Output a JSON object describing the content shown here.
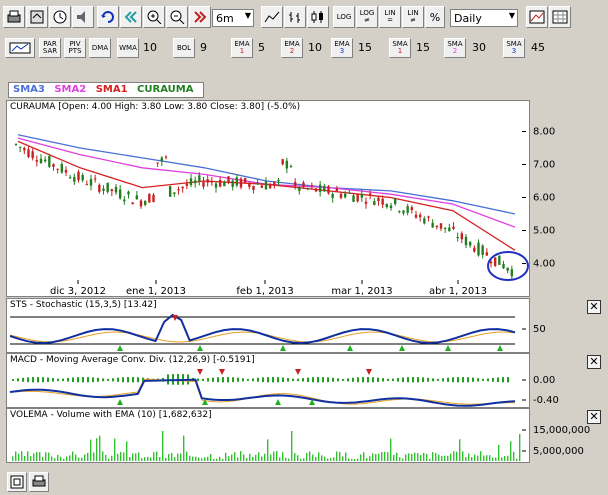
{
  "toolbar1": {
    "period_value": "6m",
    "interval_value": "Daily",
    "log_label": "LOG",
    "log_ne_label": "LOG",
    "lin_label": "LIN",
    "lin_ne_label": "LIN",
    "percent_label": "%"
  },
  "toolbar2": {
    "par_sar": "PAR SAR",
    "piv_pts": "PIV PTS",
    "dma": "DMA",
    "wma": "WMA",
    "wma_value": "10",
    "bol": "BOL",
    "bol_value": "9",
    "ema1": "EMA",
    "ema1_sub": "1",
    "ema1_value": "5",
    "ema2": "EMA",
    "ema2_sub": "2",
    "ema2_value": "10",
    "ema3": "EMA",
    "ema3_sub": "3",
    "ema3_value": "15",
    "sma1": "SMA",
    "sma1_sub": "1",
    "sma1_value": "15",
    "sma2": "SMA",
    "sma2_sub": "2",
    "sma2_value": "30",
    "sma3": "SMA",
    "sma3_sub": "3",
    "sma3_value": "45"
  },
  "legend": {
    "sma3": "SMA3",
    "sma2": "SMA2",
    "sma1": "SMA1",
    "curauma": "CURAUMA"
  },
  "colors": {
    "sma3": "#4a6fd8",
    "sma2": "#e040e0",
    "sma1": "#d82020",
    "curauma": "#208020",
    "stoch_k": "#1030a0",
    "stoch_d": "#e8a020",
    "macd": "#1030a0",
    "signal": "#e8a020",
    "volume": "#30c030"
  },
  "price_panel": {
    "header": "CURAUMA [Open: 4.00  High: 3.80  Low: 3.80  Close: 3.80] (-5.0%)",
    "y_ticks": [
      "8.00",
      "7.00",
      "6.00",
      "5.00",
      "4.00"
    ],
    "x_ticks": [
      "dic 3, 2012",
      "ene 1, 2013",
      "feb 1, 2013",
      "mar 1, 2013",
      "abr 1, 2013"
    ]
  },
  "stoch_panel": {
    "header": "STS - Stochastic (15,3,5) [13.42]",
    "y_ticks": [
      "50"
    ]
  },
  "macd_panel": {
    "header": "MACD - Moving Average Conv. Div. (12,26,9) [-0.5191]",
    "y_ticks": [
      "0.00",
      "-0.40"
    ]
  },
  "vol_panel": {
    "header": "VOLEMA - Volume with EMA (10) [1,682,632]",
    "y_ticks": [
      "15,000,000",
      "5,000,000"
    ]
  },
  "chart_data": {
    "type": "line",
    "title": "CURAUMA",
    "x": [
      "dic 3, 2012",
      "ene 1, 2013",
      "feb 1, 2013",
      "mar 1, 2013",
      "abr 1, 2013"
    ],
    "ylim": [
      3.5,
      8.5
    ],
    "series": [
      {
        "name": "SMA3",
        "values": [
          7.9,
          7.5,
          7.2,
          6.9,
          6.5,
          6.3,
          6.2,
          5.9,
          5.5
        ]
      },
      {
        "name": "SMA2",
        "values": [
          7.8,
          7.3,
          6.9,
          6.7,
          6.4,
          6.3,
          6.1,
          5.8,
          5.1
        ]
      },
      {
        "name": "SMA1",
        "values": [
          7.7,
          6.9,
          6.3,
          6.5,
          6.4,
          6.2,
          6.0,
          5.6,
          4.4
        ]
      },
      {
        "name": "CURAUMA",
        "values": [
          7.6,
          6.6,
          5.9,
          6.5,
          6.4,
          6.2,
          5.9,
          5.0,
          3.8
        ]
      }
    ]
  }
}
